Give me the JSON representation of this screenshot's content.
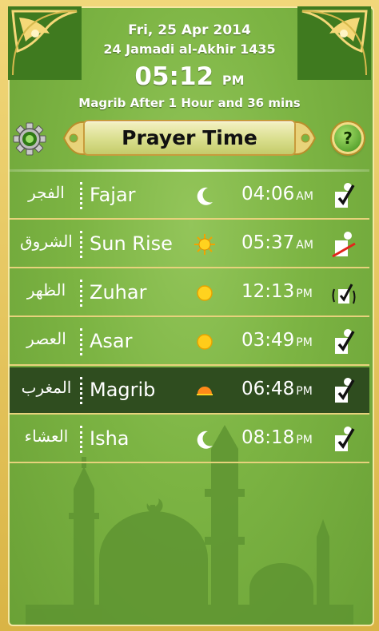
{
  "header": {
    "date": "Fri, 25 Apr 2014",
    "hijri_date": "24 Jamadi al-Akhir 1435",
    "current_time": "05:12",
    "current_ampm": "PM",
    "next_prayer_info": "Magrib After 1 Hour and 36 mins"
  },
  "toolbar": {
    "title": "Prayer Time",
    "settings_icon": "gear-icon",
    "help_label": "?"
  },
  "prayers": [
    {
      "arabic": "الفجر",
      "name": "Fajar",
      "time": "04:06",
      "ampm": "AM",
      "icon": "crescent-moon-icon",
      "alarm": "alarm-on-icon",
      "active": false
    },
    {
      "arabic": "الشروق",
      "name": "Sun Rise",
      "time": "05:37",
      "ampm": "AM",
      "icon": "sun-rays-icon",
      "alarm": "alarm-off-icon",
      "active": false
    },
    {
      "arabic": "الظهر",
      "name": "Zuhar",
      "time": "12:13",
      "ampm": "PM",
      "icon": "sun-icon",
      "alarm": "alarm-sound-icon",
      "active": false
    },
    {
      "arabic": "العصر",
      "name": "Asar",
      "time": "03:49",
      "ampm": "PM",
      "icon": "sun-icon",
      "alarm": "alarm-on-icon",
      "active": false
    },
    {
      "arabic": "المغرب",
      "name": "Magrib",
      "time": "06:48",
      "ampm": "PM",
      "icon": "sunset-icon",
      "alarm": "alarm-on-icon",
      "active": true
    },
    {
      "arabic": "العشاء",
      "name": "Isha",
      "time": "08:18",
      "ampm": "PM",
      "icon": "crescent-moon-icon",
      "alarm": "alarm-on-icon",
      "active": false
    }
  ],
  "colors": {
    "background_green": "#7cb443",
    "gold_border": "#e7d27c",
    "active_row": "#2f4d1f",
    "text": "#ffffff"
  }
}
